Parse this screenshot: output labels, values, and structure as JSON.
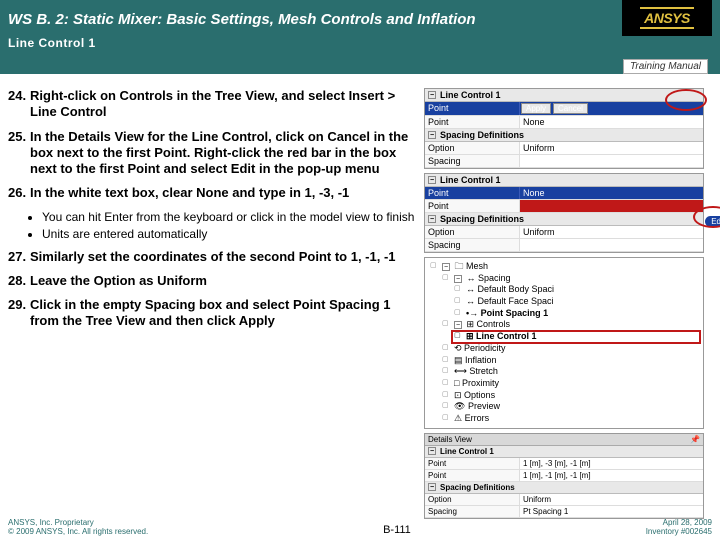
{
  "header": {
    "title": "WS B. 2: Static Mixer: Basic Settings, Mesh Controls and Inflation",
    "subtitle": "Line Control 1",
    "training": "Training Manual",
    "logo": "ANSYS"
  },
  "steps": [
    {
      "num": "24",
      "text": "Right-click on Controls in the Tree View, and select Insert > Line Control"
    },
    {
      "num": "25",
      "text": "In the Details View for the Line Control, click on Cancel in the box next to the first Point. Right-click the red bar in the box next to the first Point and select Edit in the pop-up menu"
    },
    {
      "num": "26",
      "text": "In the white text box, clear None and type in 1, -3, -1"
    }
  ],
  "bullets": [
    "You can hit Enter from the keyboard or click in the model view to finish",
    "Units are entered automatically"
  ],
  "steps2": [
    {
      "num": "27",
      "text": "Similarly set the coordinates of the second Point to 1, -1, -1"
    },
    {
      "num": "28",
      "text": "Leave the Option as Uniform"
    },
    {
      "num": "29",
      "text": "Click in the empty Spacing box and select Point Spacing 1 from the Tree View and then click Apply"
    }
  ],
  "panel1": {
    "title": "Line Control 1",
    "row_point": {
      "label": "Point",
      "btn_apply": "Apply",
      "btn_cancel": "Cancel"
    },
    "row_point2": {
      "label": "Point",
      "value": "None"
    },
    "spacing_head": "Spacing Definitions",
    "row_option": {
      "label": "Option",
      "value": "Uniform"
    },
    "row_spacing": {
      "label": "Spacing",
      "value": ""
    }
  },
  "panel2": {
    "title": "Line Control 1",
    "row_point1": {
      "label": "Point",
      "value": "None"
    },
    "row_point2": {
      "label": "Point",
      "value": ""
    },
    "spacing_head": "Spacing Definitions",
    "row_option": {
      "label": "Option",
      "value": "Uniform"
    },
    "row_spacing": {
      "label": "Spacing",
      "value": ""
    },
    "edit_label": "Edit"
  },
  "tree": {
    "mesh": "Mesh",
    "spacing": "Spacing",
    "def_body": "Default Body Spaci",
    "def_face": "Default Face Spaci",
    "point_spacing": "Point Spacing 1",
    "controls": "Controls",
    "line_control": "Line Control 1",
    "periodicity": "Periodicity",
    "inflation": "Inflation",
    "stretch": "Stretch",
    "proximity": "Proximity",
    "options": "Options",
    "preview": "Preview",
    "errors": "Errors"
  },
  "details": {
    "head": "Details View",
    "title": "Line Control 1",
    "row_point1": {
      "label": "Point",
      "value": "1 [m], -3 [m], -1 [m]"
    },
    "row_point2": {
      "label": "Point",
      "value": "1 [m], -1 [m], -1 [m]"
    },
    "spacing_head": "Spacing Definitions",
    "row_option": {
      "label": "Option",
      "value": "Uniform"
    },
    "row_spacing": {
      "label": "Spacing",
      "value": "Pt Spacing 1"
    }
  },
  "footer": {
    "proprietary": "ANSYS, Inc. Proprietary",
    "copyright": "© 2009 ANSYS, Inc. All rights reserved.",
    "page": "B-111",
    "date": "April 28, 2009",
    "inventory": "Inventory #002645"
  }
}
